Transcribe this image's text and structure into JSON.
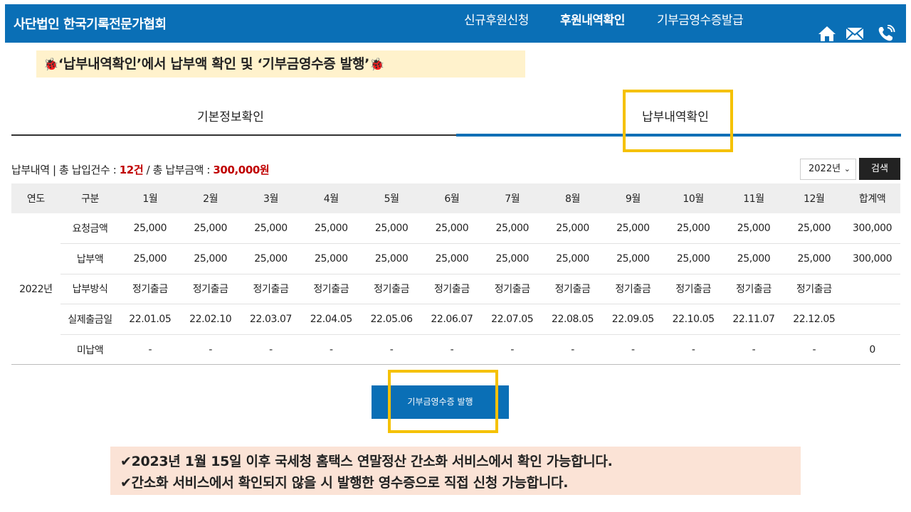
{
  "header": {
    "org_name": "사단법인 한국기록전문가협회",
    "nav": [
      "신규후원신청",
      "후원내역확인",
      "기부금영수증발급"
    ],
    "icons": [
      "home-icon",
      "mail-icon",
      "phone-icon"
    ],
    "bg_color": "#0a6fb6"
  },
  "notice": {
    "bug_left": "🐞",
    "text": "‘납부내역확인’에서 납부액 확인 및 ‘기부금영수증 발행’",
    "bug_right": "🐞"
  },
  "tabs": [
    "기본정보확인",
    "납부내역확인"
  ],
  "summary": {
    "prefix": "납부내역 | 총 납입건수 : ",
    "count": "12건",
    "middle": " / 총 납부금액 : ",
    "amount": "300,000원"
  },
  "year_select": {
    "value": "2022년"
  },
  "search_label": "검색",
  "table": {
    "headers": [
      "연도",
      "구분",
      "1월",
      "2월",
      "3월",
      "4월",
      "5월",
      "6월",
      "7월",
      "8월",
      "9월",
      "10월",
      "11월",
      "12월",
      "합계액"
    ],
    "year": "2022년",
    "rows": [
      {
        "label": "요청금액",
        "cells": [
          "25,000",
          "25,000",
          "25,000",
          "25,000",
          "25,000",
          "25,000",
          "25,000",
          "25,000",
          "25,000",
          "25,000",
          "25,000",
          "25,000",
          "300,000"
        ]
      },
      {
        "label": "납부액",
        "cells": [
          "25,000",
          "25,000",
          "25,000",
          "25,000",
          "25,000",
          "25,000",
          "25,000",
          "25,000",
          "25,000",
          "25,000",
          "25,000",
          "25,000",
          "300,000"
        ]
      },
      {
        "label": "납부방식",
        "cells": [
          "정기출금",
          "정기출금",
          "정기출금",
          "정기출금",
          "정기출금",
          "정기출금",
          "정기출금",
          "정기출금",
          "정기출금",
          "정기출금",
          "정기출금",
          "정기출금",
          ""
        ]
      },
      {
        "label": "실제출금일",
        "cells": [
          "22.01.05",
          "22.02.10",
          "22.03.07",
          "22.04.05",
          "22.05.06",
          "22.06.07",
          "22.07.05",
          "22.08.05",
          "22.09.05",
          "22.10.05",
          "22.11.07",
          "22.12.05",
          ""
        ]
      },
      {
        "label": "미납액",
        "cells": [
          "-",
          "-",
          "-",
          "-",
          "-",
          "-",
          "-",
          "-",
          "-",
          "-",
          "-",
          "-",
          "0"
        ]
      }
    ]
  },
  "issue_button": "기부금영수증 발행",
  "notes": [
    "✔2023년 1월 15일 이후 국세청 홈택스 연말정산 간소화 서비스에서 확인 가능합니다.",
    "✔간소화 서비스에서 확인되지 않을 시 발행한 영수증으로 직접 신청 가능합니다."
  ],
  "colors": {
    "accent": "#0a6fb6",
    "highlight": "#f5c100",
    "red": "#c00000"
  }
}
